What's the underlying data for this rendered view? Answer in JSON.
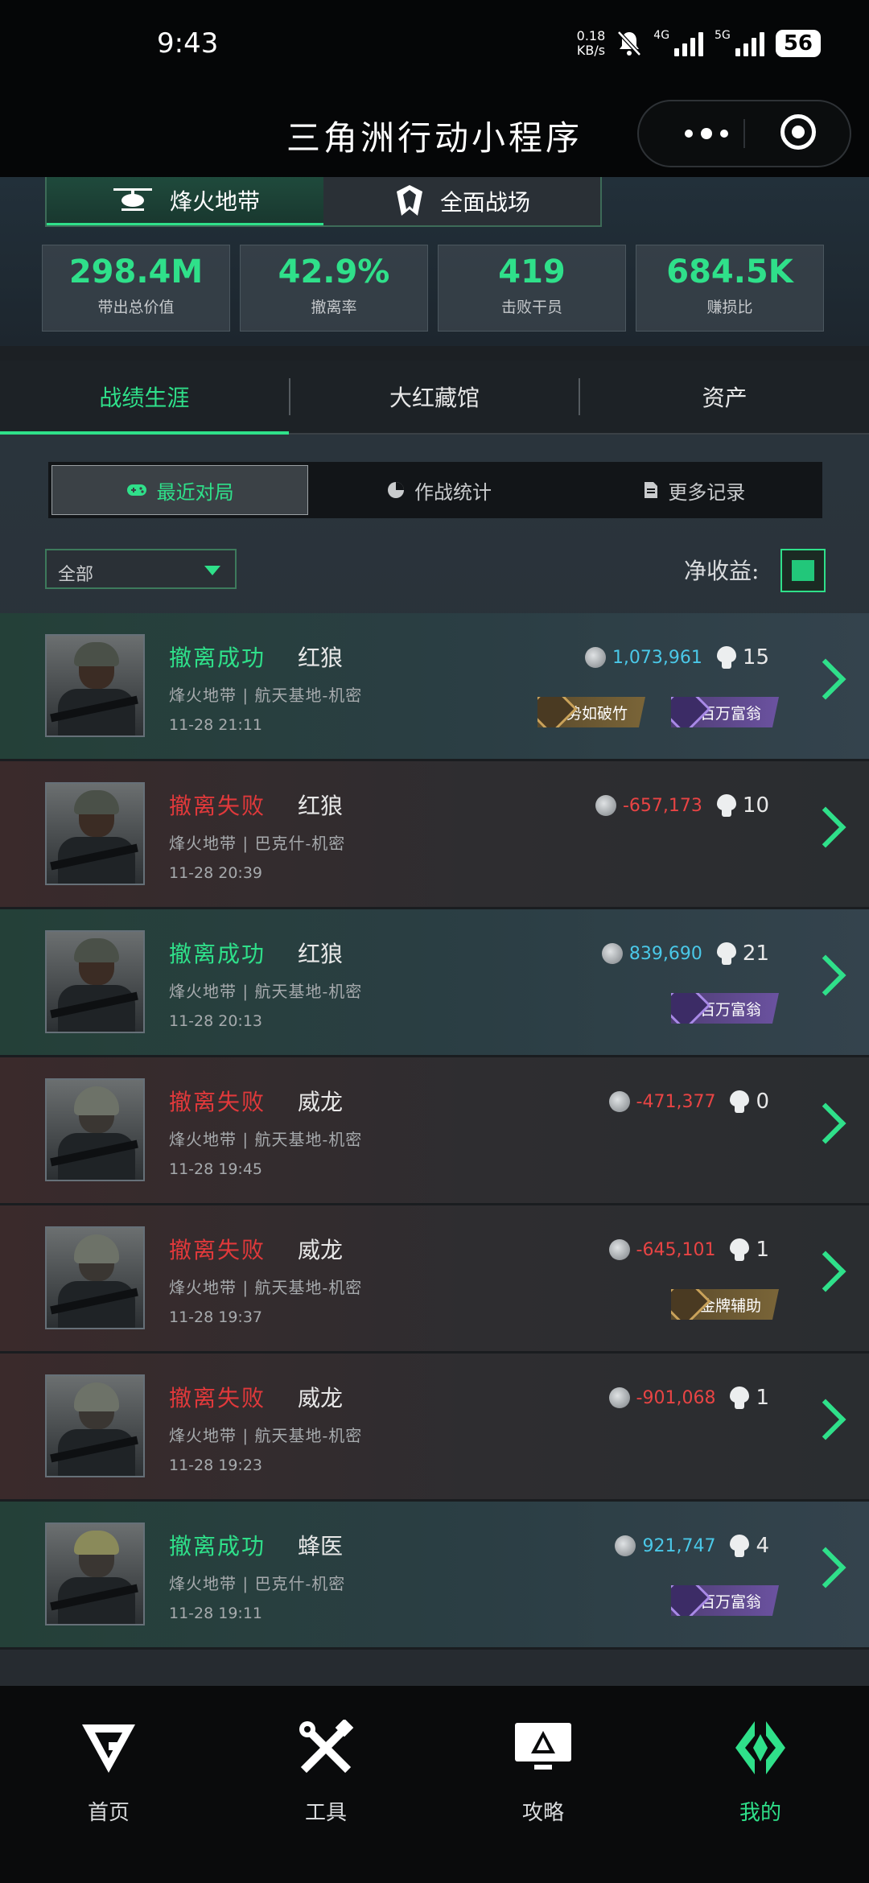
{
  "status_bar": {
    "time": "9:43",
    "net_speed_top": "0.18",
    "net_speed_bottom": "KB/s",
    "signal1_label": "4G",
    "signal2_label": "5G",
    "battery": "56"
  },
  "header": {
    "title": "三角洲行动小程序"
  },
  "mode_tabs": [
    {
      "label": "烽火地带"
    },
    {
      "label": "全面战场"
    }
  ],
  "stats": [
    {
      "value": "298.4M",
      "label": "带出总价值"
    },
    {
      "value": "42.9%",
      "label": "撤离率"
    },
    {
      "value": "419",
      "label": "击败干员"
    },
    {
      "value": "684.5K",
      "label": "赚损比"
    }
  ],
  "main_tabs": [
    {
      "label": "战绩生涯"
    },
    {
      "label": "大红藏馆"
    },
    {
      "label": "资产"
    }
  ],
  "sub_tabs": [
    {
      "label": "最近对局"
    },
    {
      "label": "作战统计"
    },
    {
      "label": "更多记录"
    }
  ],
  "filter": {
    "value": "全部",
    "net_label": "净收益:"
  },
  "colors": {
    "accent": "#2fe08a",
    "win": "#2fe08a",
    "lose": "#e0393b",
    "value_pos": "#4ac8e8",
    "value_neg": "#e84444"
  },
  "matches": [
    {
      "result": "撤离成功",
      "operator": "红狼",
      "map": "烽火地带 | 航天基地-机密",
      "time": "11-28 21:11",
      "value": "1,073,961",
      "kills": "15",
      "badges": [
        "势如破竹",
        "百万富翁"
      ]
    },
    {
      "result": "撤离失败",
      "operator": "红狼",
      "map": "烽火地带 | 巴克什-机密",
      "time": "11-28 20:39",
      "value": "-657,173",
      "kills": "10",
      "badges": []
    },
    {
      "result": "撤离成功",
      "operator": "红狼",
      "map": "烽火地带 | 航天基地-机密",
      "time": "11-28 20:13",
      "value": "839,690",
      "kills": "21",
      "badges": [
        "百万富翁"
      ]
    },
    {
      "result": "撤离失败",
      "operator": "威龙",
      "map": "烽火地带 | 航天基地-机密",
      "time": "11-28 19:45",
      "value": "-471,377",
      "kills": "0",
      "badges": []
    },
    {
      "result": "撤离失败",
      "operator": "威龙",
      "map": "烽火地带 | 航天基地-机密",
      "time": "11-28 19:37",
      "value": "-645,101",
      "kills": "1",
      "badges": [
        "金牌辅助"
      ]
    },
    {
      "result": "撤离失败",
      "operator": "威龙",
      "map": "烽火地带 | 航天基地-机密",
      "time": "11-28 19:23",
      "value": "-901,068",
      "kills": "1",
      "badges": []
    },
    {
      "result": "撤离成功",
      "operator": "蜂医",
      "map": "烽火地带 | 巴克什-机密",
      "time": "11-28 19:11",
      "value": "921,747",
      "kills": "4",
      "badges": [
        "百万富翁"
      ]
    }
  ],
  "bottom_nav": [
    {
      "label": "首页"
    },
    {
      "label": "工具"
    },
    {
      "label": "攻略"
    },
    {
      "label": "我的"
    }
  ]
}
